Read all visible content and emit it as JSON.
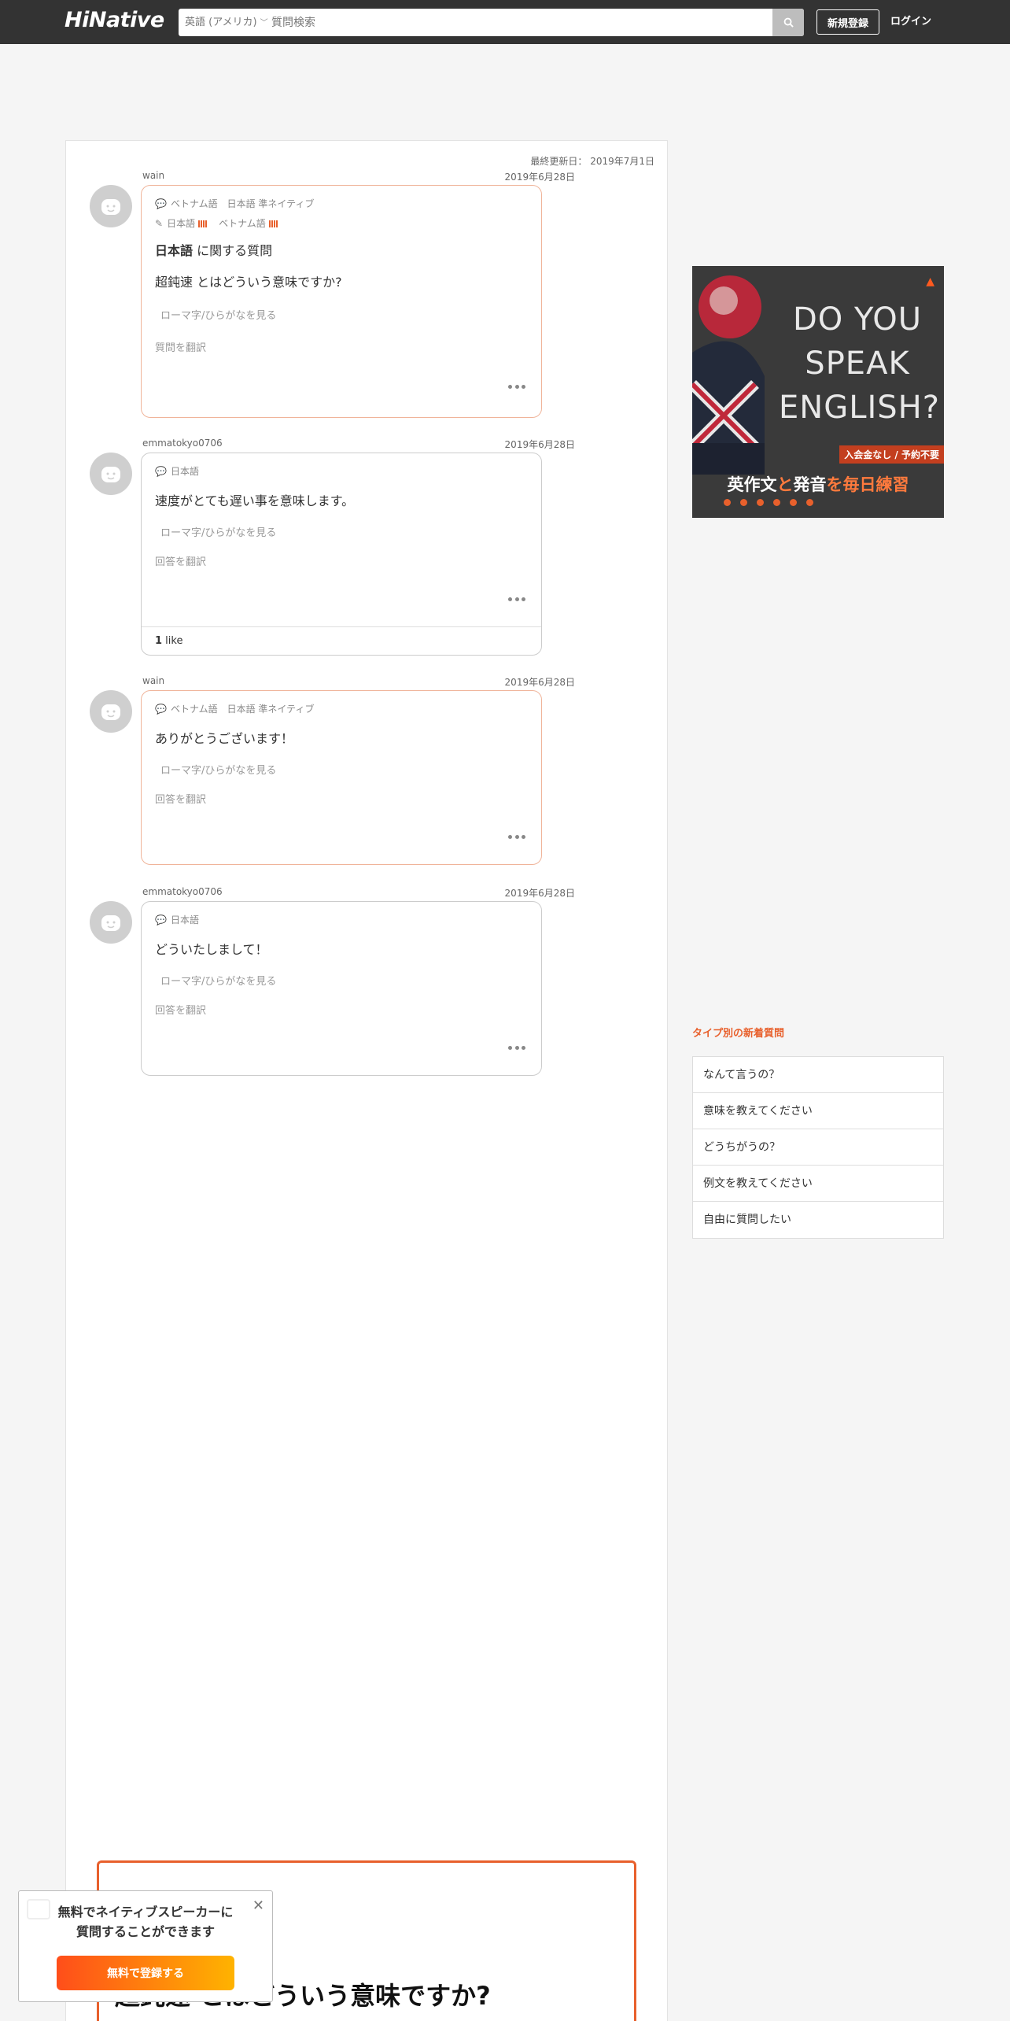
{
  "header": {
    "logo": "HiNative",
    "language": "英語 (アメリカ)",
    "search_placeholder": "質問検索",
    "signup_label": "新規登録",
    "login_label": "ログイン"
  },
  "question": {
    "updated": "最終更新日： 2019年7月1日",
    "user": "wain",
    "date": "2019年6月28日",
    "native_line": "ベトナム語　日本語 準ネイティブ",
    "study_lang_1": "日本語",
    "study_lang_2": "ベトナム語",
    "title_bold": "日本語",
    "title_rest": " に関する質問",
    "text": "超鈍速 とはどういう意味ですか?",
    "romaji": "ローマ字/ひらがなを見る",
    "translate": "質問を翻訳"
  },
  "answers": [
    {
      "user": "emmatokyo0706",
      "date": "2019年6月28日",
      "lang": "日本語",
      "text": "速度がとても遅い事を意味します。",
      "romaji": "ローマ字/ひらがなを見る",
      "translate": "回答を翻訳",
      "likes": "1",
      "likes_label": " like"
    },
    {
      "user": "wain",
      "date": "2019年6月28日",
      "lang": "ベトナム語　日本語 準ネイティブ",
      "text": "ありがとうございます！",
      "romaji": "ローマ字/ひらがなを見る",
      "translate": "回答を翻訳"
    },
    {
      "user": "emmatokyo0706",
      "date": "2019年6月28日",
      "lang": "日本語",
      "text": "どういたしまして！",
      "romaji": "ローマ字/ひらがなを見る",
      "translate": "回答を翻訳"
    }
  ],
  "ad": {
    "headline": "DO YOU SPEAK ENGLISH?",
    "badge": "入会金なし / 予約不要",
    "caption_1": "英作文",
    "caption_2": "と",
    "caption_3": "発音",
    "caption_4": "を毎日練習"
  },
  "sidebar": {
    "type_title": "タイプ別の新着質問",
    "types": [
      "なんて言うの？",
      "意味を教えてください",
      "どうちがうの？",
      "例文を教えてください",
      "自由に質問したい"
    ]
  },
  "bottom": {
    "title": "超鈍速 とはどういう意味ですか?"
  },
  "popup": {
    "line1": "無料でネイティブスピーカーに",
    "line2": "質問することができます",
    "button": "無料で登録する"
  },
  "colors": {
    "header_bg": "#333333",
    "accent": "#e8602c"
  }
}
